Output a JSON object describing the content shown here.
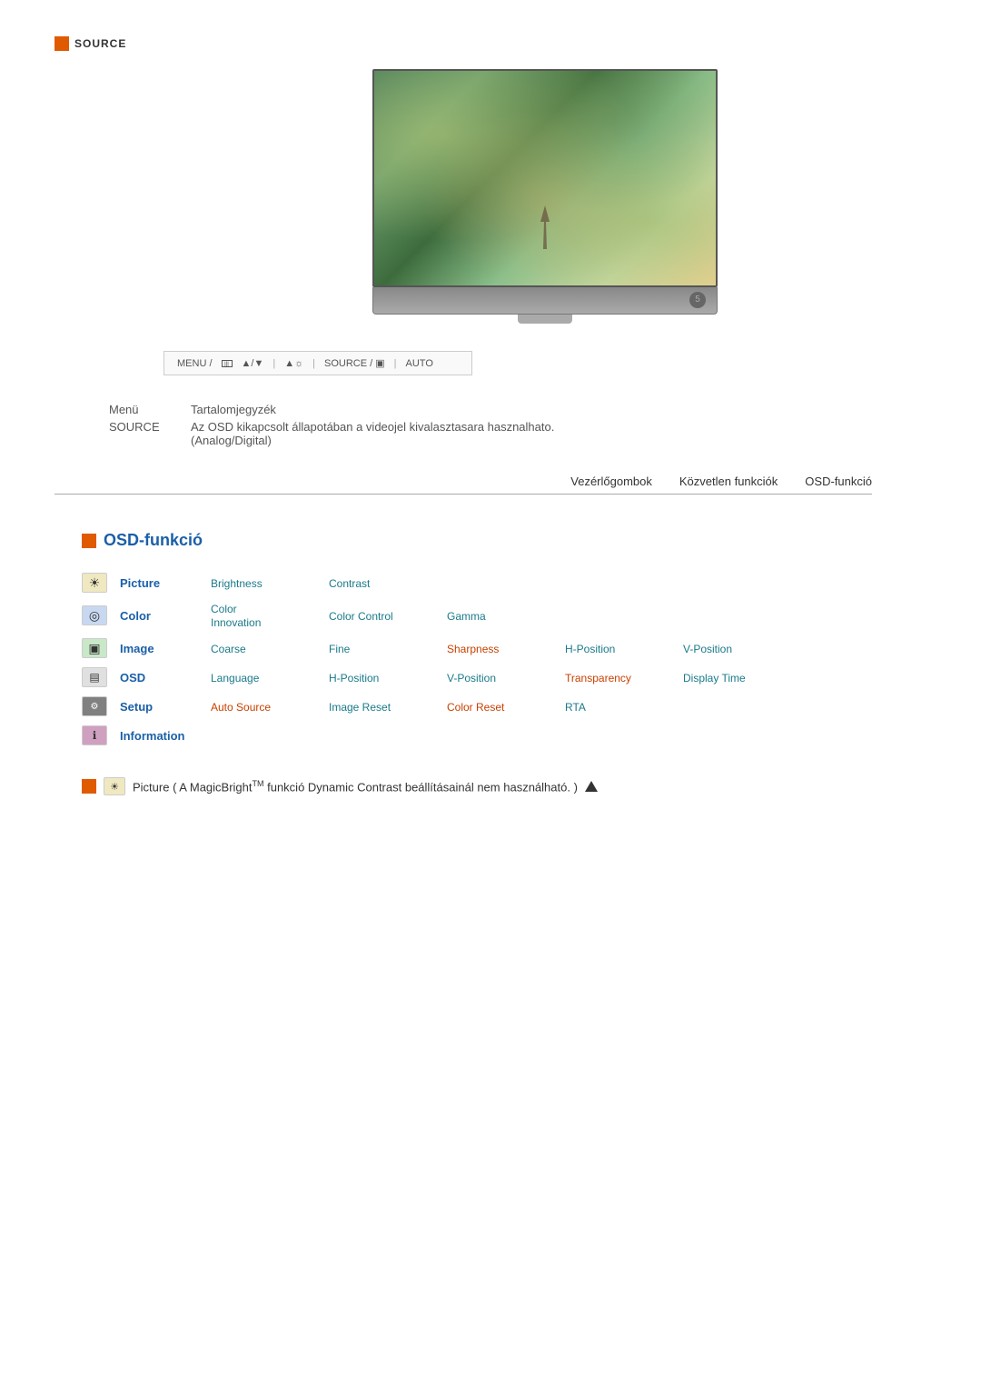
{
  "source_header": {
    "label": "SOURCE"
  },
  "control_bar": {
    "menu": "MENU /",
    "arrows": "▲/▼",
    "brightness": "▲☼",
    "source": "SOURCE / ▣",
    "auto": "AUTO"
  },
  "menu_table": {
    "col1_header": "Menü",
    "col2_header": "Tartalomjegyzék",
    "row": {
      "label": "SOURCE",
      "description": "Az OSD kikapcsolt állapotában a videojel kivalasztasara hasznalhato.",
      "sub": "(Analog/Digital)"
    }
  },
  "nav_tabs": [
    {
      "label": "Vezérlőgombok"
    },
    {
      "label": "Közvetlen funkciók"
    },
    {
      "label": "OSD-funkció"
    }
  ],
  "osd_section": {
    "title": "OSD-funkció",
    "rows": [
      {
        "icon_type": "yellow",
        "icon_text": "☀",
        "name": "Picture",
        "sub1": "Brightness",
        "sub2": "Contrast",
        "sub3": "",
        "sub4": "",
        "sub5": ""
      },
      {
        "icon_type": "blue",
        "icon_text": "◎",
        "name": "Color",
        "sub1": "Color\nInnovation",
        "sub2": "Color Control",
        "sub3": "Gamma",
        "sub4": "",
        "sub5": ""
      },
      {
        "icon_type": "green",
        "icon_text": "▣",
        "name": "Image",
        "sub1": "Coarse",
        "sub2": "Fine",
        "sub3": "Sharpness",
        "sub4": "H-Position",
        "sub5": "V-Position"
      },
      {
        "icon_type": "gray",
        "icon_text": "▤",
        "name": "OSD",
        "sub1": "Language",
        "sub2": "H-Position",
        "sub3": "V-Position",
        "sub4": "Transparency",
        "sub5": "Display Time"
      },
      {
        "icon_type": "dark",
        "icon_text": "⚙",
        "name": "Setup",
        "sub1": "Auto Source",
        "sub2": "Image Reset",
        "sub3": "Color Reset",
        "sub4": "RTA",
        "sub5": ""
      },
      {
        "icon_type": "orange",
        "icon_text": "ℹ",
        "name": "Information",
        "sub1": "",
        "sub2": "",
        "sub3": "",
        "sub4": "",
        "sub5": ""
      }
    ]
  },
  "bottom_note": {
    "text": "Picture ( A MagicBright",
    "tm": "TM",
    "text2": " funkció Dynamic Contrast beállításainál nem használható. )"
  }
}
